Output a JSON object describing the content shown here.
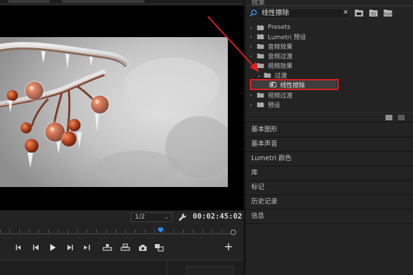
{
  "monitor": {
    "resolution": "1/2",
    "timecode": "00:02:45:02",
    "playhead_position": 0.68
  },
  "effects_panel": {
    "tab_title": "效果",
    "search_value": "线性擦除",
    "tree": [
      {
        "label": "Presets",
        "level": 0,
        "expanded": false,
        "icon": "bin-star-icon"
      },
      {
        "label": "Lumetri 预设",
        "level": 0,
        "expanded": false,
        "icon": "bin-star-icon"
      },
      {
        "label": "音频效果",
        "level": 0,
        "expanded": false,
        "icon": "folder-icon"
      },
      {
        "label": "音频过渡",
        "level": 0,
        "expanded": false,
        "icon": "folder-icon"
      },
      {
        "label": "视频效果",
        "level": 0,
        "expanded": true,
        "icon": "folder-icon"
      },
      {
        "label": "过渡",
        "level": 1,
        "expanded": true,
        "icon": "folder-icon"
      },
      {
        "label": "线性擦除",
        "level": 2,
        "expanded": false,
        "icon": "effect-icon",
        "selected": true
      },
      {
        "label": "视频过渡",
        "level": 0,
        "expanded": false,
        "icon": "folder-icon"
      },
      {
        "label": "预设",
        "level": 0,
        "expanded": false,
        "icon": "bin-star-icon"
      }
    ]
  },
  "panels": [
    {
      "label": "基本图形"
    },
    {
      "label": "基本声音"
    },
    {
      "label": "Lumetri 颜色"
    },
    {
      "label": "库"
    },
    {
      "label": "标记"
    },
    {
      "label": "历史记录"
    },
    {
      "label": "信息"
    }
  ],
  "colors": {
    "accent_blue": "#2b8cf0",
    "annotation_red": "#e02020",
    "background": "#232323"
  }
}
